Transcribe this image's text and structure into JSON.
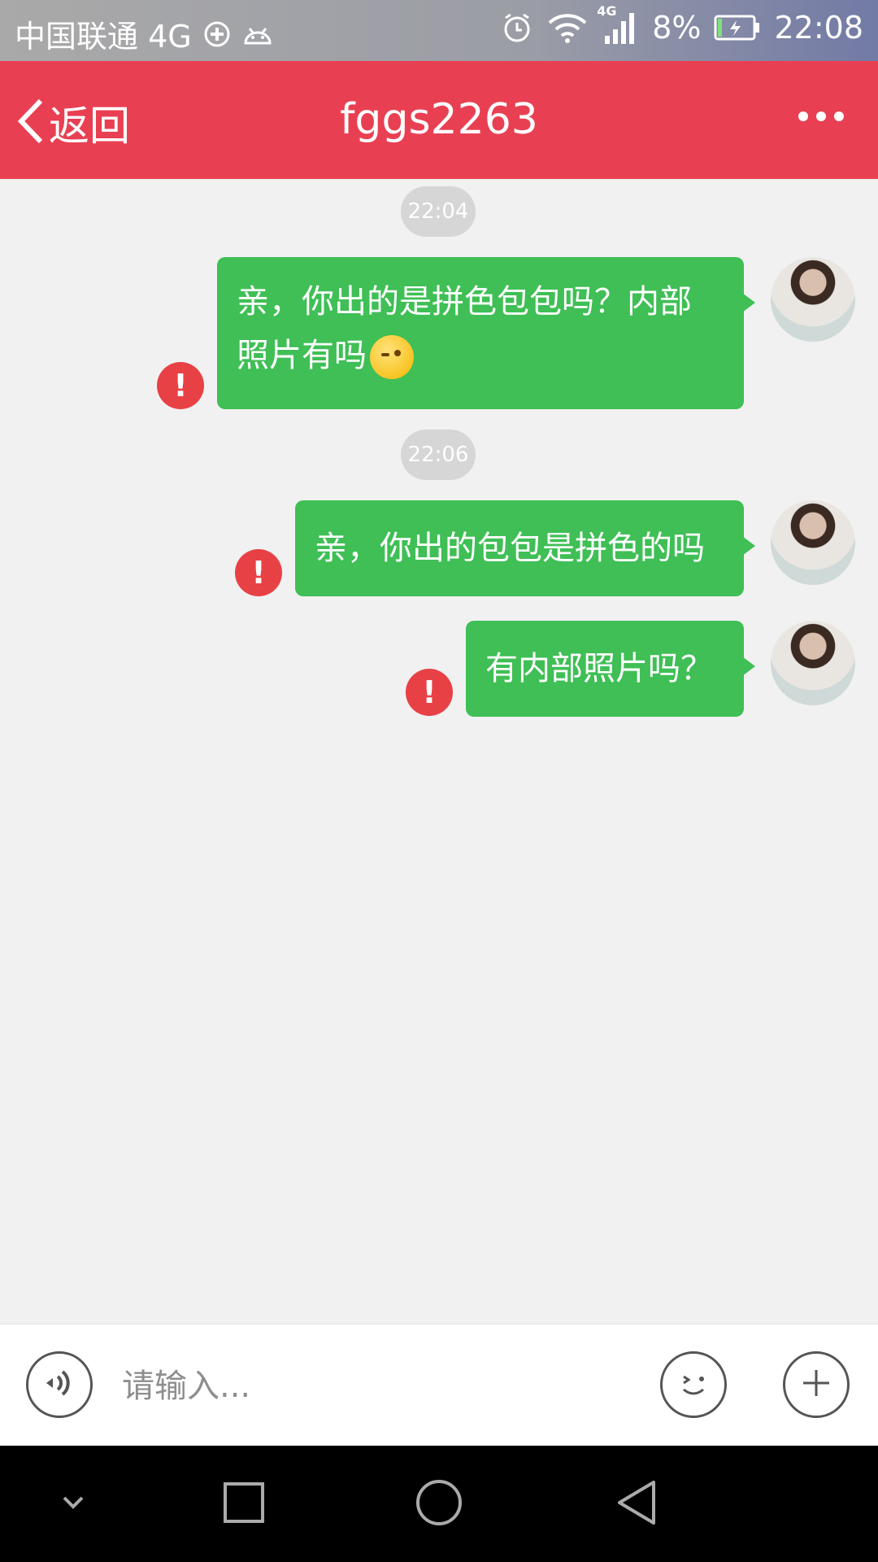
{
  "status_bar": {
    "carrier": "中国联通 4G",
    "network_label": "4G",
    "battery": "8%",
    "time": "22:08"
  },
  "header": {
    "back_label": "返回",
    "title": "fggs2263"
  },
  "messages": [
    {
      "timestamp": "22:04",
      "text_line1": "亲，你出的是拼色包包吗？内部",
      "text_line2": "照片有吗"
    },
    {
      "timestamp": "22:06",
      "text": "亲，你出的包包是拼色的吗"
    },
    {
      "text": "有内部照片吗？"
    }
  ],
  "error_badge": "!",
  "input": {
    "placeholder": "请输入..."
  },
  "colors": {
    "header": "#e84052",
    "bubble": "#3fbf55",
    "error": "#e84145",
    "background": "#f1f1f1"
  },
  "icons": {
    "voice": "voice-icon",
    "emoji": "emoji-icon",
    "plus": "plus-icon",
    "nav_down": "chevron-down-icon",
    "nav_recent": "square-icon",
    "nav_home": "circle-icon",
    "nav_back": "triangle-back-icon"
  }
}
